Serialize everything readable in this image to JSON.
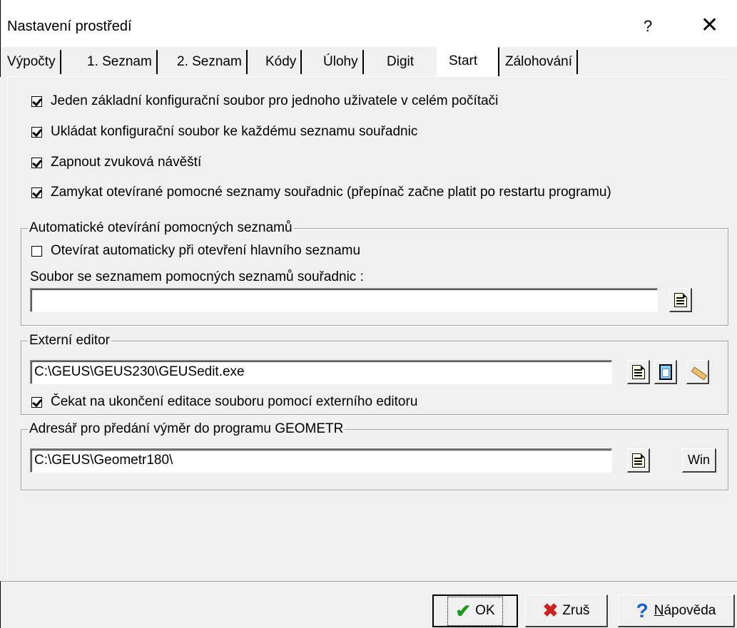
{
  "window": {
    "title": "Nastavení prostředí",
    "help_label": "?",
    "close_label": "✕"
  },
  "tabs": [
    {
      "label": "Výpočty"
    },
    {
      "label": "1. Seznam"
    },
    {
      "label": "2. Seznam"
    },
    {
      "label": "Kódy"
    },
    {
      "label": "Úlohy"
    },
    {
      "label": "Digit"
    },
    {
      "label": "Start",
      "active": true
    },
    {
      "label": "Zálohování"
    }
  ],
  "options": [
    {
      "label": "Jeden základní konfigurační soubor pro jednoho uživatele v celém počítači",
      "checked": true
    },
    {
      "label": "Ukládat konfigurační soubor ke každému seznamu souřadnic",
      "checked": true
    },
    {
      "label": "Zapnout zvuková návěští",
      "checked": true
    },
    {
      "label": "Zamykat otevírané pomocné seznamy souřadnic (přepínač začne platit po restartu programu)",
      "checked": true
    }
  ],
  "auto_open": {
    "title": "Automatické otevírání pomocných seznamů",
    "checkbox_label": "Otevírat automaticky při otevření hlavního seznamu",
    "checked": false,
    "file_label": "Soubor se seznamem pomocných seznamů souřadnic :",
    "file_value": ""
  },
  "external_editor": {
    "title": "Externí editor",
    "path_value": "C:\\GEUS\\GEUS230\\GEUSedit.exe",
    "wait_label": "Čekat na ukončení editace souboru pomocí externího editoru",
    "wait_checked": true
  },
  "geometr": {
    "title": "Adresář pro předání výměr do programu GEOMETR",
    "path_value": "C:\\GEUS\\Geometr180\\",
    "win_label": "Win"
  },
  "buttons": {
    "ok": "OK",
    "cancel": "Zruš",
    "help_prefix": "N",
    "help_rest": "ápověda"
  },
  "icons": {
    "check": "✔",
    "cross": "✖",
    "question": "?"
  }
}
